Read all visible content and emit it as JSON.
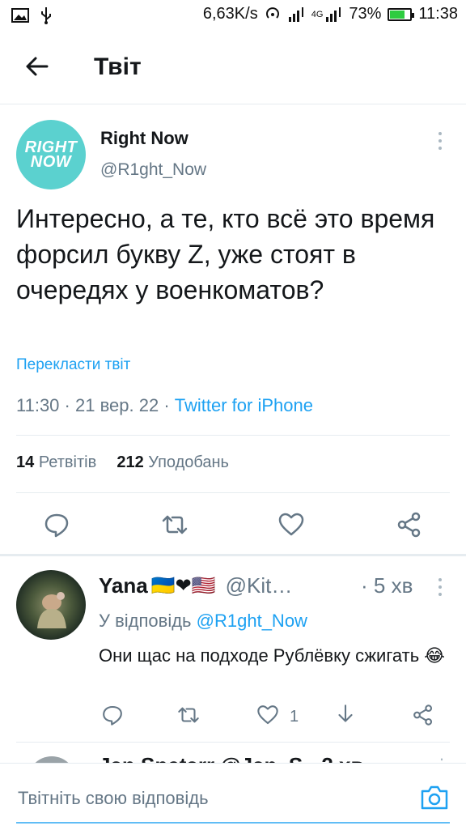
{
  "status_bar": {
    "speed": "6,63K/s",
    "network": "4G",
    "battery": "73%",
    "battery_level": 0.73,
    "time": "11:38"
  },
  "header": {
    "title": "Твіт"
  },
  "tweet": {
    "author_name": "Right Now",
    "author_handle": "@R1ght_Now",
    "avatar_logo_line1": "RIGHT",
    "avatar_logo_line2": "NOW",
    "text": "Интересно, а те, кто всё это время форсил букву Z, уже стоят в очередях у военкоматов?",
    "translate_label": "Перекласти твіт",
    "time": "11:30",
    "date": "21 вер. 22",
    "source": "Twitter for iPhone",
    "retweets_count": "14",
    "retweets_label": "Ретвітів",
    "likes_count": "212",
    "likes_label": "Уподобань"
  },
  "reply": {
    "author_name": "Yana",
    "author_emoji": "🇺🇦❤🇺🇸",
    "author_handle": "@Kit…",
    "time": "· 5 хв",
    "reply_prefix": "У відповідь",
    "reply_to": "@R1ght_Now",
    "text": "Они щас на подходе Рублёвку сжигать 😂",
    "like_count": "1"
  },
  "next_reply": {
    "partial_text": "Jan Spetarr @Jan_S · 2 хв"
  },
  "composer": {
    "placeholder": "Твітніть свою відповідь"
  },
  "colors": {
    "accent": "#1da1f2",
    "muted": "#657786",
    "avatar_teal": "#5bd1cf"
  }
}
